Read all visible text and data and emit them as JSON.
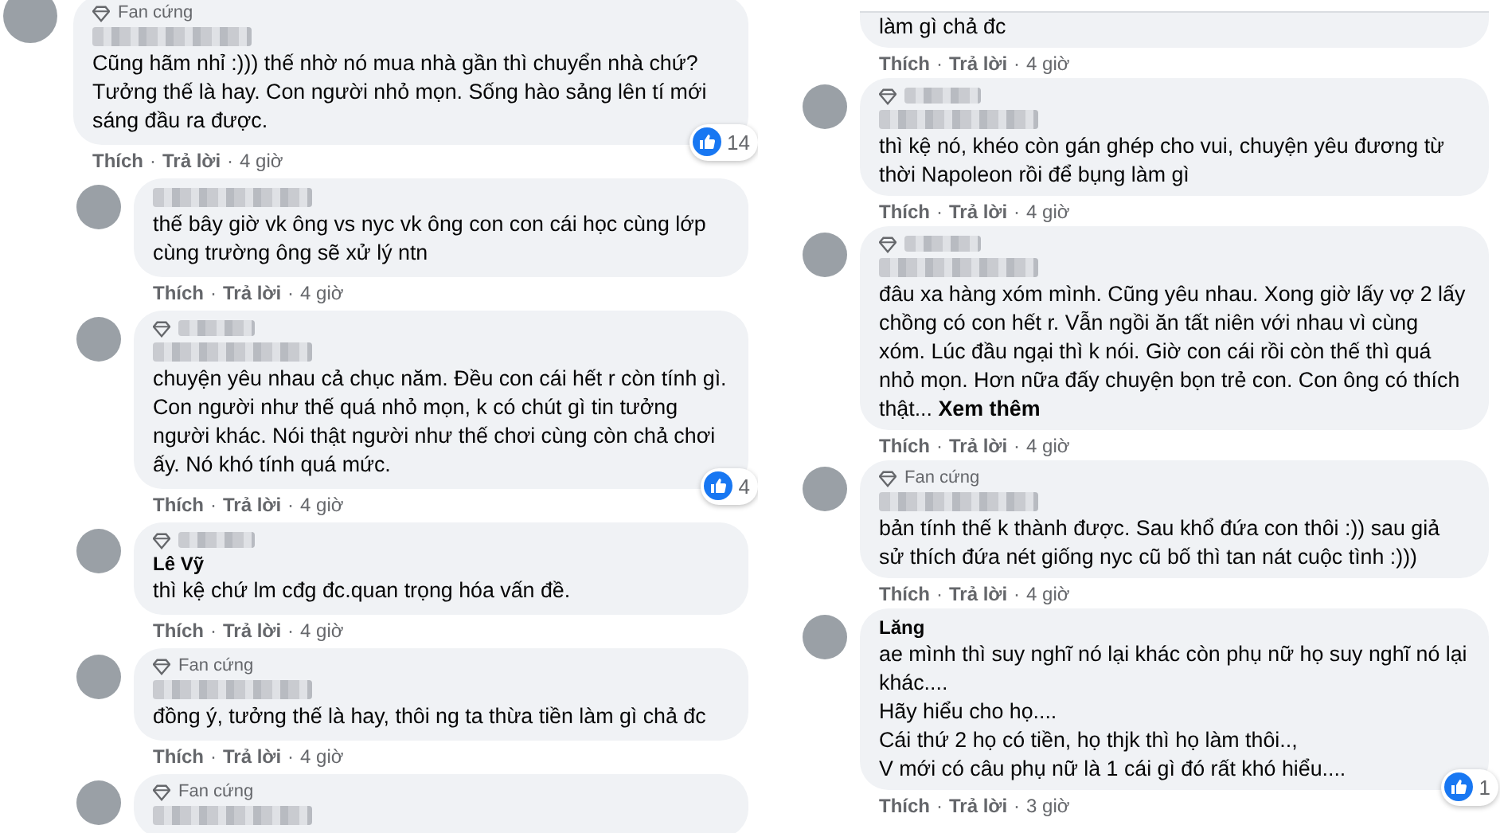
{
  "separator": "·",
  "columns": [
    {
      "comments": [
        {
          "badge": {
            "text": "Fan cứng"
          },
          "name": {
            "blurred": true
          },
          "text": "Cũng hãm nhỉ :))) thế nhờ nó mua nhà gần thì chuyển nhà chứ? Tưởng thế là hay. Con người nhỏ mọn. Sống hào sảng lên tí mới sáng đầu ra được.",
          "like": "Thích",
          "reply": "Trả lời",
          "time": "4 giờ",
          "reactions": "14",
          "children": [
            {
              "name": {
                "blurred": true
              },
              "text": "thế bây giờ vk ông vs nyc vk ông con con cái học cùng lớp cùng trường ông sẽ xử lý ntn",
              "like": "Thích",
              "reply": "Trả lời",
              "time": "4 giờ"
            },
            {
              "badge": {
                "blurred": true
              },
              "name": {
                "blurred": true
              },
              "text": "chuyện yêu nhau cả chục năm. Đều con cái hết r còn tính gì. Con người như thế quá nhỏ mọn, k có chút gì tin tưởng người khác. Nói thật người như thế chơi cùng còn chả chơi ấy. Nó khó tính quá mức.",
              "like": "Thích",
              "reply": "Trả lời",
              "time": "4 giờ",
              "reactions": "4"
            },
            {
              "badge": {
                "blurred": true
              },
              "name": {
                "text": "Lê Vỹ"
              },
              "text": "thì kệ chứ lm cđg đc.quan trọng hóa vấn đề.",
              "like": "Thích",
              "reply": "Trả lời",
              "time": "4 giờ"
            },
            {
              "badge": {
                "text": "Fan cứng"
              },
              "name": {
                "blurred": true
              },
              "text": "đồng ý, tưởng thế là hay, thôi ng ta thừa tiền làm gì chả đc",
              "like": "Thích",
              "reply": "Trả lời",
              "time": "4 giờ"
            },
            {
              "badge": {
                "text": "Fan cứng"
              },
              "name": {
                "blurred": true
              }
            }
          ]
        }
      ]
    },
    {
      "comments": [
        {
          "cut_top": true,
          "text": "làm gì chả đc",
          "like": "Thích",
          "reply": "Trả lời",
          "time": "4 giờ"
        },
        {
          "badge": {
            "blurred": true
          },
          "name": {
            "blurred": true
          },
          "text": "thì kệ nó, khéo còn gán ghép cho vui, chuyện yêu đương từ thời Napoleon rồi để bụng làm gì",
          "like": "Thích",
          "reply": "Trả lời",
          "time": "4 giờ"
        },
        {
          "badge": {
            "blurred": true
          },
          "name": {
            "blurred": true
          },
          "text": "đâu xa hàng xóm mình. Cũng yêu nhau. Xong giờ lấy vợ 2 lấy chồng có con hết r. Vẫn ngồi ăn tất niên với nhau vì cùng xóm. Lúc đầu ngại thì k nói. Giờ con cái rồi còn thế thì quá nhỏ mọn. Hơn nữa đấy chuyện bọn trẻ con. Con ông có thích thật...",
          "see_more": "Xem thêm",
          "like": "Thích",
          "reply": "Trả lời",
          "time": "4 giờ"
        },
        {
          "badge": {
            "text": "Fan cứng"
          },
          "name": {
            "blurred": true
          },
          "text": "bản tính thế k thành được. Sau khổ đứa con thôi :)) sau giả sử thích đứa nét giống nyc cũ bố thì tan nát cuộc tình :)))",
          "like": "Thích",
          "reply": "Trả lời",
          "time": "4 giờ"
        },
        {
          "name": {
            "text": "Lăng"
          },
          "text": "ae mình thì suy nghĩ nó lại khác còn phụ nữ họ suy nghĩ nó lại khác....\nHãy hiểu cho họ....\nCái thứ 2 họ có tiền, họ thjk thì họ làm thôi..,\nV mới có câu phụ nữ là 1 cái gì đó rất khó hiểu....",
          "like": "Thích",
          "reply": "Trả lời",
          "time": "3 giờ",
          "reactions": "1"
        }
      ]
    }
  ]
}
